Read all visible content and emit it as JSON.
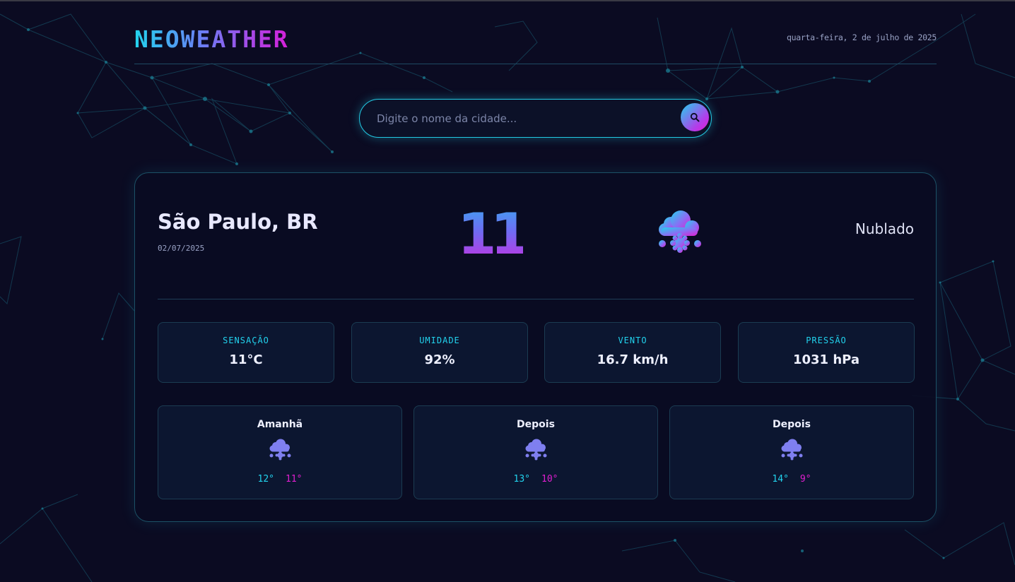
{
  "header": {
    "logo": "NEOWEATHER",
    "date": "quarta-feira, 2 de julho de 2025"
  },
  "search": {
    "placeholder": "Digite o nome da cidade...",
    "button_icon": "search-icon"
  },
  "current": {
    "city": "São Paulo, BR",
    "date": "02/07/2025",
    "temperature": "11",
    "icon": "cloud-snow-icon",
    "description": "Nublado"
  },
  "stats": [
    {
      "label": "SENSAÇÃO",
      "value": "11°C"
    },
    {
      "label": "UMIDADE",
      "value": "92%"
    },
    {
      "label": "VENTO",
      "value": "16.7 km/h"
    },
    {
      "label": "PRESSÃO",
      "value": "1031 hPa"
    }
  ],
  "forecast": [
    {
      "day": "Amanhã",
      "icon": "cloud-snow-icon",
      "max": "12°",
      "min": "11°"
    },
    {
      "day": "Depois",
      "icon": "cloud-snow-icon",
      "max": "13°",
      "min": "10°"
    },
    {
      "day": "Depois",
      "icon": "cloud-snow-icon",
      "max": "14°",
      "min": "9°"
    }
  ],
  "colors": {
    "background": "#0b0b22",
    "accent_cyan": "#22d3ee",
    "accent_magenta": "#e11fd0",
    "accent_violet": "#6d7cf5"
  }
}
